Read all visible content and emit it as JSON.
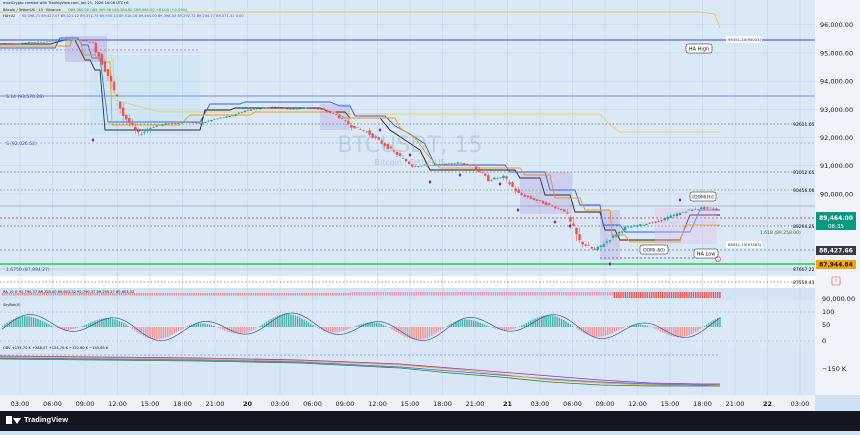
{
  "header": {
    "created_line": "moziCrypto created with TradingView.com, Jan 21, 2026 18:06 UTC+6",
    "symbol_line": "Bitcoin / TetherUS · 15 · Binance",
    "symbol_values": "O89,380.00 H89,499.98 L89,284.80 C89,464.00 +81.00 (+0.09%)",
    "indicator_line": "HA+AI",
    "indicator_values": "90,098.71  89,427.07  89,421.12  89,371.75  89,950.14  89,518.16  89,464.00  89,398.00  89,292.72  89,204.77  89,371.31  0.00"
  },
  "watermark": {
    "symbol": "BTCUSDT, 15",
    "name": "Bitcoin / TetherUS"
  },
  "labels": {
    "ha_high": "HA High",
    "ha_low": "HA Low",
    "dom_h": "[DOM(H)]",
    "dom_l": "DOM(-60)",
    "fib_top": "S.14 (93,570.28)",
    "fib_mid": "S (92,026.52)",
    "fib_bottom": "1.6750 (87,894.27)",
    "fib_right": "1.618 (89,258.00)",
    "ref_top": "95451.20(95024)",
    "ref_low": "88941.10(87463)",
    "lvl_92631": "92631.05",
    "lvl_91012": "91012.65",
    "lvl_90456": "90456.00",
    "lvl_89294": "89294.25",
    "lvl_87667": "87667.22",
    "lvl_87550": "87550.43"
  },
  "price_axis": {
    "ticks": [
      "96,000.00",
      "95,000.00",
      "94,000.00",
      "93,000.00",
      "92,000.00",
      "91,000.00",
      "90,000.00",
      "89,000.00"
    ],
    "current_price": "89,464.00",
    "countdown": "08:35",
    "badge_2": "88,427.66",
    "badge_3": "87,944.84",
    "colors": {
      "current": "#089981",
      "badge_2": "#363a45",
      "badge_3": "#f7a600"
    }
  },
  "pane2": {
    "legend": "RA 10  ⊙  92,790.37  88,228.00  89,603.52  92,790.37  89,295.27  89,603.52",
    "axis_tick": "90,000.00"
  },
  "pane3": {
    "legend": "SkyBot(0)",
    "axis_ticks": [
      "100",
      "50",
      "0"
    ]
  },
  "pane4": {
    "legend": "OBV  +154.70 K  +288.07  +154.70 K  −122.60 K  −145.65 K",
    "axis_tick": "−150 K"
  },
  "time_axis": {
    "labels": [
      "03:00",
      "06:00",
      "09:00",
      "12:00",
      "15:00",
      "18:00",
      "21:00",
      "20",
      "03:00",
      "06:00",
      "09:00",
      "12:00",
      "15:00",
      "18:00",
      "21:00",
      "21",
      "03:00",
      "06:00",
      "09:00",
      "12:00",
      "15:00",
      "18:00",
      "21:00",
      "22",
      "03:00"
    ]
  },
  "footer": {
    "brand": "TradingView"
  },
  "chart_data": {
    "type": "candlestick",
    "title": "Bitcoin / TetherUS · 15 · Binance",
    "ylim": [
      87300,
      96700
    ],
    "y_ticks": [
      96000,
      95000,
      94000,
      93000,
      92000,
      91000,
      90000,
      89000
    ],
    "ohlc_path": [
      [
        95350,
        95350,
        95200,
        95330
      ],
      [
        95330,
        95400,
        95250,
        95380
      ],
      [
        95380,
        95420,
        95300,
        95400
      ],
      [
        95400,
        95480,
        95380,
        95450
      ],
      [
        95450,
        95520,
        95400,
        95480
      ],
      [
        95480,
        95500,
        95300,
        95360
      ],
      [
        95360,
        95380,
        94100,
        94200
      ],
      [
        94200,
        94300,
        92700,
        92800
      ],
      [
        92800,
        92900,
        91900,
        92100
      ],
      [
        92100,
        92500,
        92000,
        92400
      ],
      [
        92400,
        92600,
        92300,
        92500
      ],
      [
        92500,
        92600,
        92400,
        92550
      ],
      [
        92550,
        92650,
        92450,
        92500
      ],
      [
        92500,
        92700,
        92450,
        92650
      ],
      [
        92650,
        92800,
        92600,
        92750
      ],
      [
        92750,
        93000,
        92700,
        92950
      ],
      [
        92950,
        93100,
        92850,
        93050
      ],
      [
        93050,
        93200,
        92950,
        93100
      ],
      [
        93100,
        93150,
        92900,
        93000
      ],
      [
        93000,
        93100,
        92900,
        93050
      ],
      [
        93050,
        93150,
        92950,
        93000
      ],
      [
        93000,
        93050,
        92700,
        92800
      ],
      [
        92800,
        92900,
        92300,
        92400
      ],
      [
        92400,
        92500,
        92100,
        92200
      ],
      [
        92200,
        92300,
        91700,
        91800
      ],
      [
        91800,
        91900,
        91300,
        91400
      ],
      [
        91400,
        91500,
        90900,
        91000
      ],
      [
        91000,
        91200,
        90800,
        91000
      ],
      [
        91000,
        91100,
        90900,
        91050
      ],
      [
        91050,
        91150,
        90950,
        91100
      ],
      [
        91100,
        91200,
        90950,
        91000
      ],
      [
        91000,
        91100,
        90400,
        90500
      ],
      [
        90500,
        90700,
        90200,
        90600
      ],
      [
        90600,
        90700,
        89900,
        90000
      ],
      [
        90000,
        90100,
        89700,
        89800
      ],
      [
        89800,
        89900,
        89500,
        89600
      ],
      [
        89600,
        89700,
        89300,
        89400
      ],
      [
        89400,
        89700,
        88200,
        88300
      ],
      [
        88300,
        88500,
        87800,
        88000
      ],
      [
        88000,
        88500,
        87900,
        88400
      ],
      [
        88400,
        88900,
        88300,
        88800
      ],
      [
        88800,
        89000,
        88700,
        88900
      ],
      [
        88900,
        89100,
        88800,
        89000
      ],
      [
        89000,
        89300,
        88900,
        89200
      ],
      [
        89200,
        89500,
        89100,
        89400
      ],
      [
        89400,
        89700,
        89300,
        89500
      ],
      [
        89500,
        89650,
        89280,
        89464
      ]
    ]
  }
}
